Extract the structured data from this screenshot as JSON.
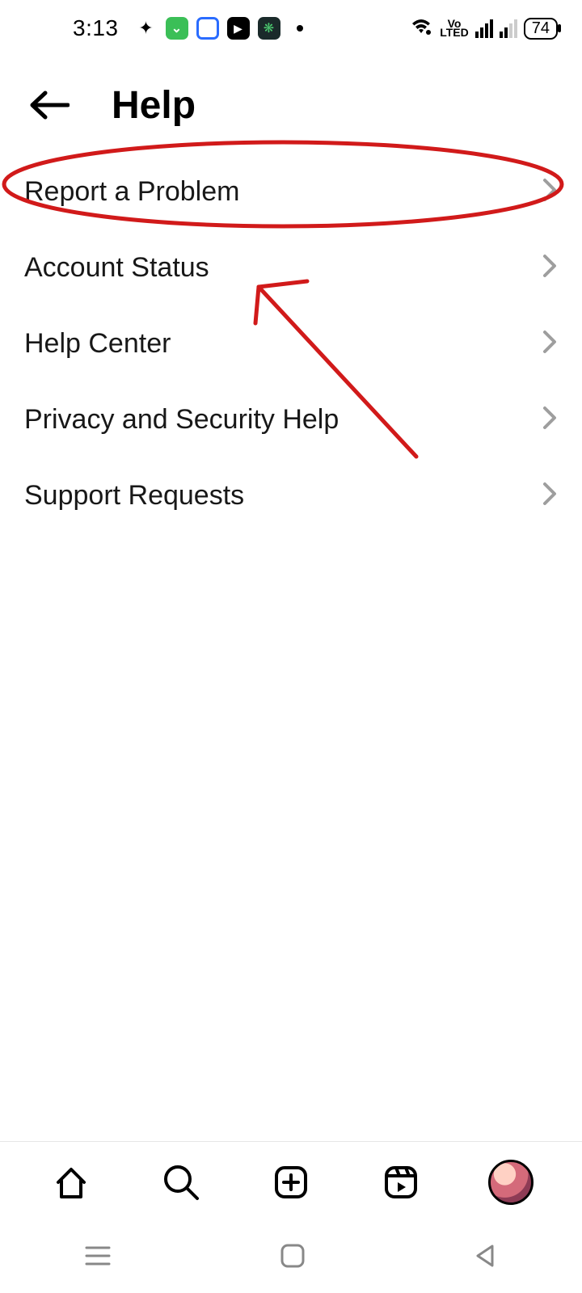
{
  "status": {
    "time": "3:13",
    "battery": "74",
    "volte_top": "Vo",
    "volte_bottom": "LTED"
  },
  "header": {
    "title": "Help"
  },
  "menu": {
    "items": [
      {
        "label": "Report a Problem"
      },
      {
        "label": "Account Status"
      },
      {
        "label": "Help Center"
      },
      {
        "label": "Privacy and Security Help"
      },
      {
        "label": "Support Requests"
      }
    ]
  },
  "annotation": {
    "highlighted_item_index": 0,
    "color": "#d11a1a"
  }
}
